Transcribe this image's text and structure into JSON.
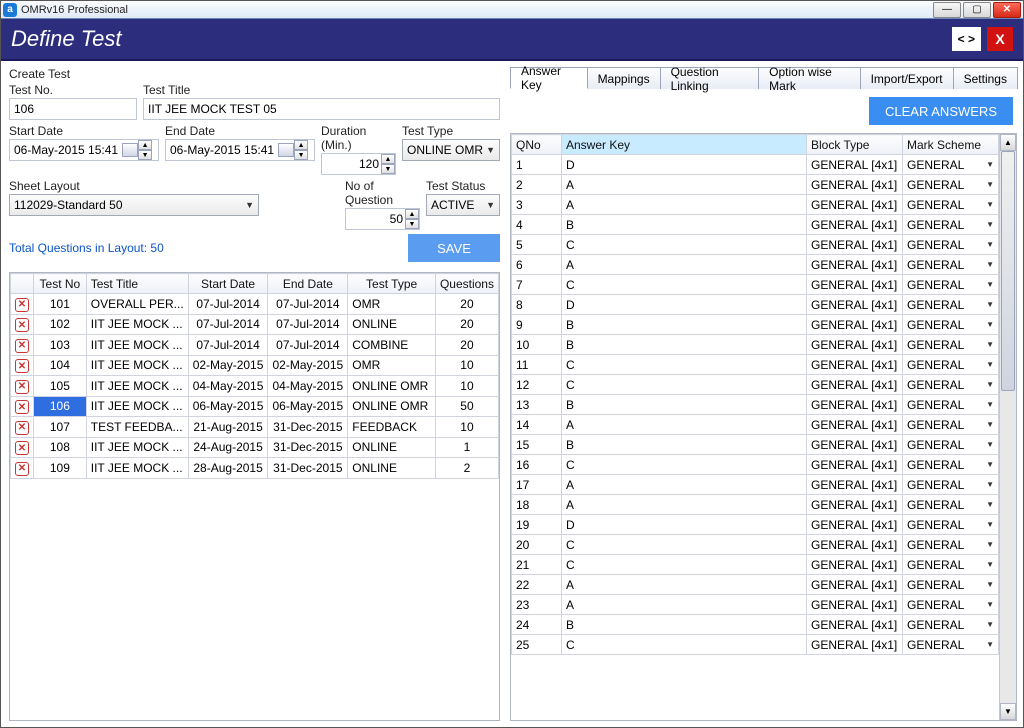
{
  "window": {
    "title": "OMRv16 Professional"
  },
  "header": {
    "title": "Define Test",
    "nav": "< >",
    "close": "X"
  },
  "form": {
    "group": "Create Test",
    "testNoLabel": "Test No.",
    "testNo": "106",
    "testTitleLabel": "Test Title",
    "testTitle": "IIT JEE MOCK TEST 05",
    "startDateLabel": "Start Date",
    "startDate": "06-May-2015 15:41",
    "endDateLabel": "End Date",
    "endDate": "06-May-2015 15:41",
    "durationLabel": "Duration (Min.)",
    "duration": "120",
    "testTypeLabel": "Test Type",
    "testType": "ONLINE OMR",
    "sheetLayoutLabel": "Sheet Layout",
    "sheetLayout": "112029-Standard 50",
    "noQLabel": "No of Question",
    "noQ": "50",
    "statusLabel": "Test Status",
    "status": "ACTIVE",
    "totalQ": "Total Questions in Layout: 50",
    "save": "SAVE"
  },
  "gridHeaders": {
    "testNo": "Test No",
    "title": "Test Title",
    "start": "Start Date",
    "end": "End Date",
    "type": "Test Type",
    "q": "Questions"
  },
  "tests": [
    {
      "no": "101",
      "title": "OVERALL PER...",
      "start": "07-Jul-2014",
      "end": "07-Jul-2014",
      "type": "OMR",
      "q": "20"
    },
    {
      "no": "102",
      "title": "IIT JEE MOCK ...",
      "start": "07-Jul-2014",
      "end": "07-Jul-2014",
      "type": "ONLINE",
      "q": "20"
    },
    {
      "no": "103",
      "title": "IIT JEE MOCK ...",
      "start": "07-Jul-2014",
      "end": "07-Jul-2014",
      "type": "COMBINE",
      "q": "20"
    },
    {
      "no": "104",
      "title": "IIT JEE MOCK ...",
      "start": "02-May-2015",
      "end": "02-May-2015",
      "type": "OMR",
      "q": "10"
    },
    {
      "no": "105",
      "title": "IIT JEE MOCK ...",
      "start": "04-May-2015",
      "end": "04-May-2015",
      "type": "ONLINE OMR",
      "q": "10"
    },
    {
      "no": "106",
      "title": "IIT JEE MOCK ...",
      "start": "06-May-2015",
      "end": "06-May-2015",
      "type": "ONLINE OMR",
      "q": "50"
    },
    {
      "no": "107",
      "title": "TEST FEEDBA...",
      "start": "21-Aug-2015",
      "end": "31-Dec-2015",
      "type": "FEEDBACK",
      "q": "10"
    },
    {
      "no": "108",
      "title": "IIT JEE MOCK ...",
      "start": "24-Aug-2015",
      "end": "31-Dec-2015",
      "type": "ONLINE",
      "q": "1"
    },
    {
      "no": "109",
      "title": "IIT JEE MOCK ...",
      "start": "28-Aug-2015",
      "end": "31-Dec-2015",
      "type": "ONLINE",
      "q": "2"
    }
  ],
  "selectedTestNo": "106",
  "tabs": {
    "answerKey": "Answer Key",
    "mappings": "Mappings",
    "linking": "Question Linking",
    "optionMark": "Option wise Mark",
    "importExport": "Import/Export",
    "settings": "Settings"
  },
  "clearBtn": "CLEAR ANSWERS",
  "ansHeaders": {
    "qno": "QNo",
    "key": "Answer Key",
    "block": "Block Type",
    "scheme": "Mark Scheme"
  },
  "blockType": "GENERAL [4x1]",
  "markScheme": "GENERAL",
  "answers": [
    {
      "q": "1",
      "k": "D"
    },
    {
      "q": "2",
      "k": "A"
    },
    {
      "q": "3",
      "k": "A"
    },
    {
      "q": "4",
      "k": "B"
    },
    {
      "q": "5",
      "k": "C"
    },
    {
      "q": "6",
      "k": "A"
    },
    {
      "q": "7",
      "k": "C"
    },
    {
      "q": "8",
      "k": "D"
    },
    {
      "q": "9",
      "k": "B"
    },
    {
      "q": "10",
      "k": "B"
    },
    {
      "q": "11",
      "k": "C"
    },
    {
      "q": "12",
      "k": "C"
    },
    {
      "q": "13",
      "k": "B"
    },
    {
      "q": "14",
      "k": "A"
    },
    {
      "q": "15",
      "k": "B"
    },
    {
      "q": "16",
      "k": "C"
    },
    {
      "q": "17",
      "k": "A"
    },
    {
      "q": "18",
      "k": "A"
    },
    {
      "q": "19",
      "k": "D"
    },
    {
      "q": "20",
      "k": "C"
    },
    {
      "q": "21",
      "k": "C"
    },
    {
      "q": "22",
      "k": "A"
    },
    {
      "q": "23",
      "k": "A"
    },
    {
      "q": "24",
      "k": "B"
    },
    {
      "q": "25",
      "k": "C"
    }
  ]
}
